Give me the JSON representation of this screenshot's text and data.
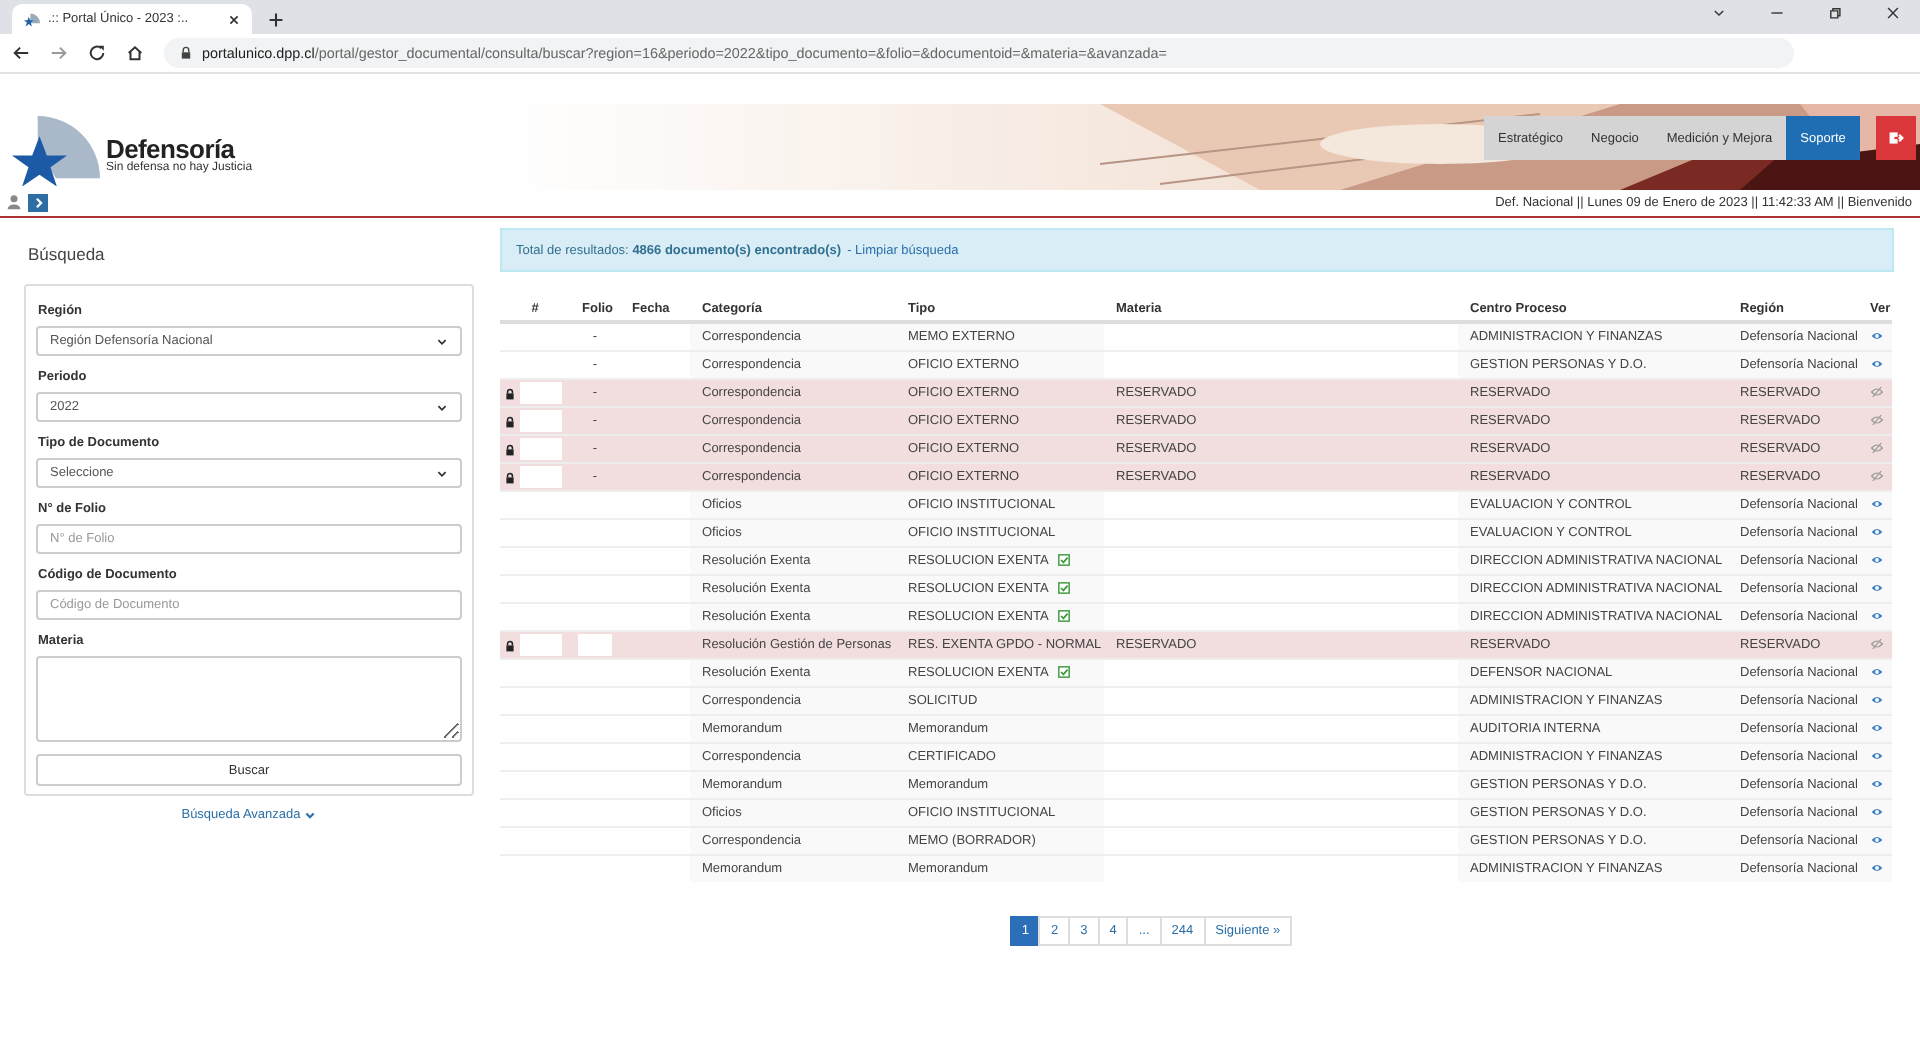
{
  "browser": {
    "tab_title": ".:: Portal Único - 2023 :..",
    "url_host": "portalunico.dpp.cl",
    "url_path": "/portal/gestor_documental/consulta/buscar?region=16&periodo=2022&tipo_documento=&folio=&documentoid=&materia=&avanzada="
  },
  "header": {
    "brand": "Defensoría",
    "tagline": "Sin defensa no hay Justicia",
    "nav": [
      {
        "label": "Estratégico",
        "selected": false
      },
      {
        "label": "Negocio",
        "selected": false
      },
      {
        "label": "Medición y Mejora",
        "selected": false
      },
      {
        "label": "Soporte",
        "selected": true
      }
    ],
    "status_line": "Def. Nacional || Lunes 09 de Enero de 2023 || 11:42:33 AM || Bienvenido"
  },
  "search": {
    "title": "Búsqueda",
    "fields": [
      {
        "kind": "select",
        "label": "Región",
        "value": "Región Defensoría Nacional"
      },
      {
        "kind": "select",
        "label": "Periodo",
        "value": "2022"
      },
      {
        "kind": "select",
        "label": "Tipo de Documento",
        "value": "Seleccione"
      },
      {
        "kind": "input",
        "label": "N° de Folio",
        "placeholder": "N° de Folio"
      },
      {
        "kind": "input",
        "label": "Código de Documento",
        "placeholder": "Código de Documento"
      },
      {
        "kind": "textarea",
        "label": "Materia"
      }
    ],
    "button": "Buscar",
    "advanced": "Búsqueda Avanzada"
  },
  "results": {
    "summary": "Total de resultados: **4866 documento(s) encontrado(s)**",
    "clear_link": "- Limpiar búsqueda"
  },
  "table": {
    "columns": [
      "#",
      "Folio",
      "Fecha",
      "Categoría",
      "Tipo",
      "Materia",
      "Centro Proceso",
      "Región",
      "Ver"
    ],
    "rows": [
      {
        "locked": false,
        "reserved": false,
        "folio": "-",
        "category": "Correspondencia",
        "type": "MEMO EXTERNO",
        "signed": false,
        "center": "ADMINISTRACION Y FINANZAS",
        "region": "Defensoría Nacional"
      },
      {
        "locked": false,
        "reserved": false,
        "folio": "-",
        "category": "Correspondencia",
        "type": "OFICIO EXTERNO",
        "signed": false,
        "center": "GESTION PERSONAS Y D.O.",
        "region": "Defensoría Nacional"
      },
      {
        "locked": true,
        "reserved": true,
        "folio": "-",
        "category": "Correspondencia",
        "type": "OFICIO EXTERNO",
        "signed": false,
        "subject": "RESERVADO",
        "center": "RESERVADO",
        "region": "RESERVADO"
      },
      {
        "locked": true,
        "reserved": true,
        "folio": "-",
        "category": "Correspondencia",
        "type": "OFICIO EXTERNO",
        "signed": false,
        "subject": "RESERVADO",
        "center": "RESERVADO",
        "region": "RESERVADO"
      },
      {
        "locked": true,
        "reserved": true,
        "folio": "-",
        "category": "Correspondencia",
        "type": "OFICIO EXTERNO",
        "signed": false,
        "subject": "RESERVADO",
        "center": "RESERVADO",
        "region": "RESERVADO"
      },
      {
        "locked": true,
        "reserved": true,
        "folio": "-",
        "category": "Correspondencia",
        "type": "OFICIO EXTERNO",
        "signed": false,
        "subject": "RESERVADO",
        "center": "RESERVADO",
        "region": "RESERVADO"
      },
      {
        "locked": false,
        "reserved": false,
        "category": "Oficios",
        "type": "OFICIO INSTITUCIONAL",
        "signed": false,
        "center": "EVALUACION Y CONTROL",
        "region": "Defensoría Nacional"
      },
      {
        "locked": false,
        "reserved": false,
        "category": "Oficios",
        "type": "OFICIO INSTITUCIONAL",
        "signed": false,
        "center": "EVALUACION Y CONTROL",
        "region": "Defensoría Nacional"
      },
      {
        "locked": false,
        "reserved": false,
        "category": "Resolución Exenta",
        "type": "RESOLUCION EXENTA",
        "signed": true,
        "center": "DIRECCION ADMINISTRATIVA NACIONAL",
        "region": "Defensoría Nacional"
      },
      {
        "locked": false,
        "reserved": false,
        "category": "Resolución Exenta",
        "type": "RESOLUCION EXENTA",
        "signed": true,
        "center": "DIRECCION ADMINISTRATIVA NACIONAL",
        "region": "Defensoría Nacional"
      },
      {
        "locked": false,
        "reserved": false,
        "category": "Resolución Exenta",
        "type": "RESOLUCION EXENTA",
        "signed": true,
        "center": "DIRECCION ADMINISTRATIVA NACIONAL",
        "region": "Defensoría Nacional"
      },
      {
        "locked": true,
        "reserved": true,
        "folio_redacted": true,
        "category": "Resolución Gestión de Personas",
        "type": "RES. EXENTA GPDO - NORMAL",
        "signed": false,
        "subject": "RESERVADO",
        "center": "RESERVADO",
        "region": "RESERVADO"
      },
      {
        "locked": false,
        "reserved": false,
        "category": "Resolución Exenta",
        "type": "RESOLUCION EXENTA",
        "signed": true,
        "center": "DEFENSOR NACIONAL",
        "region": "Defensoría Nacional"
      },
      {
        "locked": false,
        "reserved": false,
        "category": "Correspondencia",
        "type": "SOLICITUD",
        "signed": false,
        "center": "ADMINISTRACION Y FINANZAS",
        "region": "Defensoría Nacional"
      },
      {
        "locked": false,
        "reserved": false,
        "category": "Memorandum",
        "type": "Memorandum",
        "signed": false,
        "center": "AUDITORIA INTERNA",
        "region": "Defensoría Nacional"
      },
      {
        "locked": false,
        "reserved": false,
        "category": "Correspondencia",
        "type": "CERTIFICADO",
        "signed": false,
        "center": "ADMINISTRACION Y FINANZAS",
        "region": "Defensoría Nacional"
      },
      {
        "locked": false,
        "reserved": false,
        "category": "Memorandum",
        "type": "Memorandum",
        "signed": false,
        "center": "GESTION PERSONAS Y D.O.",
        "region": "Defensoría Nacional"
      },
      {
        "locked": false,
        "reserved": false,
        "category": "Oficios",
        "type": "OFICIO INSTITUCIONAL",
        "signed": false,
        "center": "GESTION PERSONAS Y D.O.",
        "region": "Defensoría Nacional"
      },
      {
        "locked": false,
        "reserved": false,
        "category": "Correspondencia",
        "type": "MEMO (BORRADOR)",
        "signed": false,
        "center": "GESTION PERSONAS Y D.O.",
        "region": "Defensoría Nacional"
      },
      {
        "locked": false,
        "reserved": false,
        "category": "Memorandum",
        "type": "Memorandum",
        "signed": false,
        "center": "ADMINISTRACION Y FINANZAS",
        "region": "Defensoría Nacional"
      }
    ]
  },
  "pagination": {
    "pages": [
      {
        "label": "1",
        "selected": true
      },
      {
        "label": "2",
        "selected": false
      },
      {
        "label": "3",
        "selected": false
      },
      {
        "label": "4",
        "selected": false
      },
      {
        "label": "...",
        "selected": false
      },
      {
        "label": "244",
        "selected": false
      }
    ],
    "next": "Siguiente »"
  }
}
